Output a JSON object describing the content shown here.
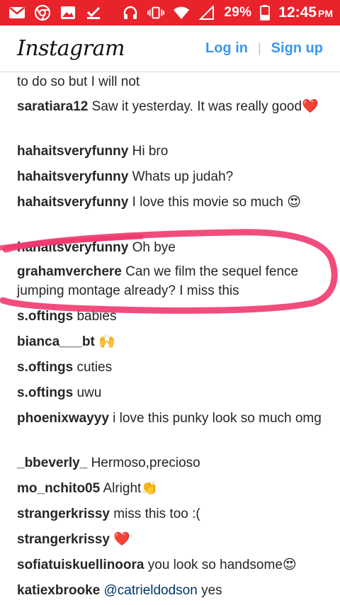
{
  "statusbar": {
    "battery": "29%",
    "time": "12:45",
    "ampm": "PM"
  },
  "header": {
    "logo": "Instagram",
    "login": "Log in",
    "divider": "|",
    "signup": "Sign up"
  },
  "comments": [
    {
      "user": "",
      "text": "to do so but I will not"
    },
    {
      "user": "saratiara12",
      "text": "Saw it yesterday. It was really good❤️"
    },
    {
      "user": "hahaitsveryfunny",
      "text": "Hi bro"
    },
    {
      "user": "hahaitsveryfunny",
      "text": "Whats up judah?"
    },
    {
      "user": "hahaitsveryfunny",
      "text": "I love this movie so much 😍"
    },
    {
      "user": "hahaitsveryfunny",
      "text": "Oh bye"
    },
    {
      "user": "grahamverchere",
      "text": "Can we film the sequel fence jumping montage already? I miss this"
    },
    {
      "user": "s.oftings",
      "text": "babies"
    },
    {
      "user": "bianca___bt",
      "text": "🙌"
    },
    {
      "user": "s.oftings",
      "text": "cuties"
    },
    {
      "user": "s.oftings",
      "text": "uwu"
    },
    {
      "user": "phoenixwayyy",
      "text": "i love this punky look so much omg"
    },
    {
      "user": "_bbeverly_",
      "text": "Hermoso,precioso"
    },
    {
      "user": "mo_nchito05",
      "text": "Alright👏"
    },
    {
      "user": "strangerkrissy",
      "text": "miss this too :("
    },
    {
      "user": "strangerkrissy",
      "text": "❤️"
    },
    {
      "user": "sofiatuiskuellinoora",
      "text": "you look so handsome😍"
    },
    {
      "user": "katiexbrooke",
      "mention": "@catrieldodson",
      "text": "yes"
    }
  ]
}
